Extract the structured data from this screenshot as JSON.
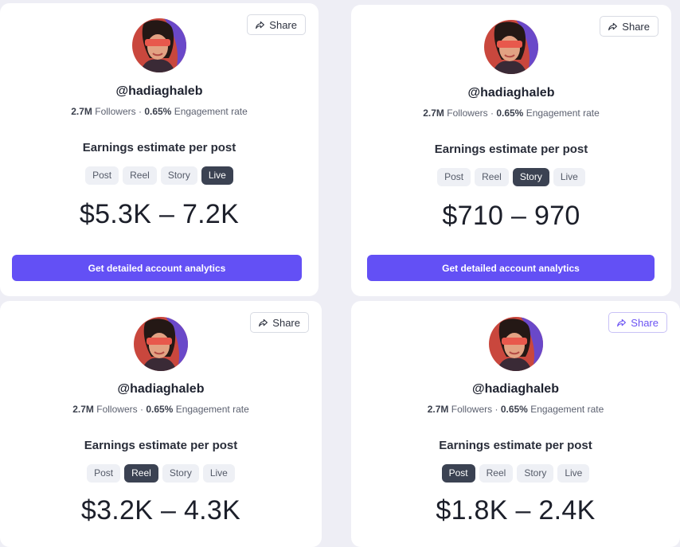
{
  "share_label": "Share",
  "handle": "@hadiaghaleb",
  "followers_value": "2.7M",
  "followers_label": "Followers",
  "separator": "·",
  "engagement_value": "0.65%",
  "engagement_label": "Engagement rate",
  "earnings_title": "Earnings estimate per post",
  "tabs": [
    "Post",
    "Reel",
    "Story",
    "Live"
  ],
  "cta_label": "Get detailed account analytics",
  "cards": [
    {
      "active_tab": "Live",
      "range": "$5.3K – 7.2K"
    },
    {
      "active_tab": "Story",
      "range": "$710 – 970"
    },
    {
      "active_tab": "Reel",
      "range": "$3.2K – 4.3K"
    },
    {
      "active_tab": "Post",
      "range": "$1.8K – 2.4K"
    }
  ],
  "colors": {
    "accent": "#6350f5",
    "active_tab": "#3b4252",
    "inactive_tab": "#eef0f5",
    "background": "#eeeef5"
  }
}
